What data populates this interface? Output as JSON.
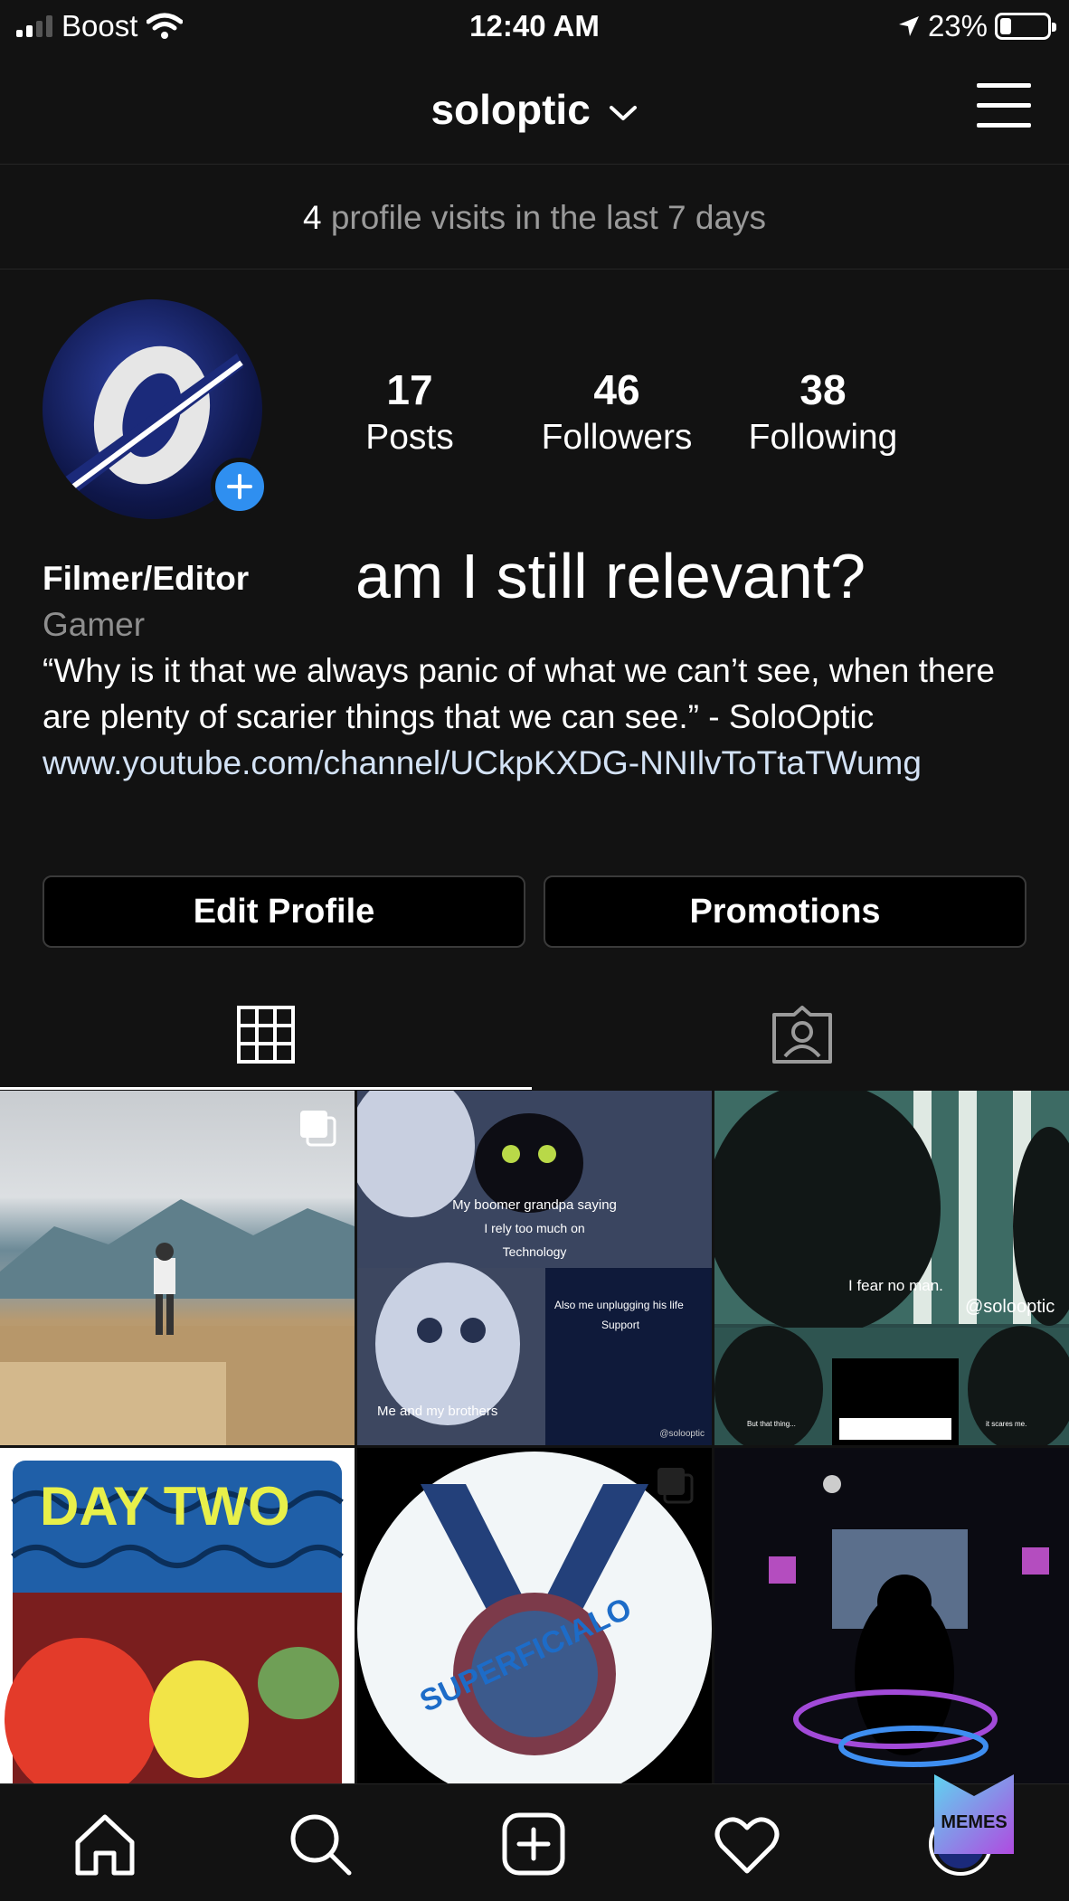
{
  "status_bar": {
    "carrier": "Boost",
    "time": "12:40 AM",
    "battery": "23%",
    "battery_level": 0.23
  },
  "header": {
    "username": "soloptic",
    "menu_icon": "hamburger-menu-icon"
  },
  "visits": {
    "count": "4",
    "text": "profile visits in the last 7 days"
  },
  "profile": {
    "stats": [
      {
        "value": "17",
        "label": "Posts"
      },
      {
        "value": "46",
        "label": "Followers"
      },
      {
        "value": "38",
        "label": "Following"
      }
    ],
    "name": "Filmer/Editor",
    "category": "Gamer",
    "bio": "“Why is it that we always panic of what we can’t see, when there are plenty of scarier things that we can see.” - SoloOptic",
    "link": "www.youtube.com/channel/UCkpKXDG-NNIlvToTtaTWumg",
    "overlay_caption": "am I still relevant?"
  },
  "buttons": {
    "edit_profile": "Edit Profile",
    "promotions": "Promotions"
  },
  "tabs": [
    {
      "icon": "grid-icon",
      "active": true
    },
    {
      "icon": "tagged-person-icon",
      "active": false
    }
  ],
  "posts": [
    {
      "index": 1,
      "icon": "multiple-photos-icon"
    },
    {
      "index": 2,
      "texts": [
        "My boomer grandpa saying",
        "I rely too much on",
        "Technology",
        "Me and my brothers",
        "Also me unplugging his life",
        "Support",
        "@solooptic"
      ]
    },
    {
      "index": 3,
      "texts": [
        "I fear no man.",
        "@solooptic",
        "But that thing...",
        "it scares me."
      ]
    },
    {
      "index": 4,
      "texts": [
        "DAY TWO"
      ]
    },
    {
      "index": 5,
      "texts": [
        "SUPERFICIALO"
      ],
      "icon": "multiple-photos-icon"
    },
    {
      "index": 6
    }
  ],
  "bottom_nav": [
    "home-icon",
    "search-icon",
    "new-post-icon",
    "activity-heart-icon",
    "profile-avatar-icon"
  ],
  "badge": "MEMES",
  "colors": {
    "background": "#121212",
    "accent_blue": "#2f8ff0",
    "button_bg": "#000000"
  }
}
